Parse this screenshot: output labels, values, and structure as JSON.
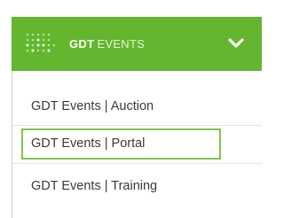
{
  "header": {
    "brand_strong": "GDT",
    "brand_light": "EVENTS",
    "logo_icon": "dot-grid-logo-icon",
    "toggle_icon": "chevron-down-icon",
    "bg_color": "#63b62d"
  },
  "menu": {
    "items": [
      {
        "label": "GDT Events | Auction"
      },
      {
        "label": "GDT Events | Portal",
        "highlighted": true
      },
      {
        "label": "GDT Events | Training"
      }
    ],
    "highlight_color": "#7dc54a"
  }
}
